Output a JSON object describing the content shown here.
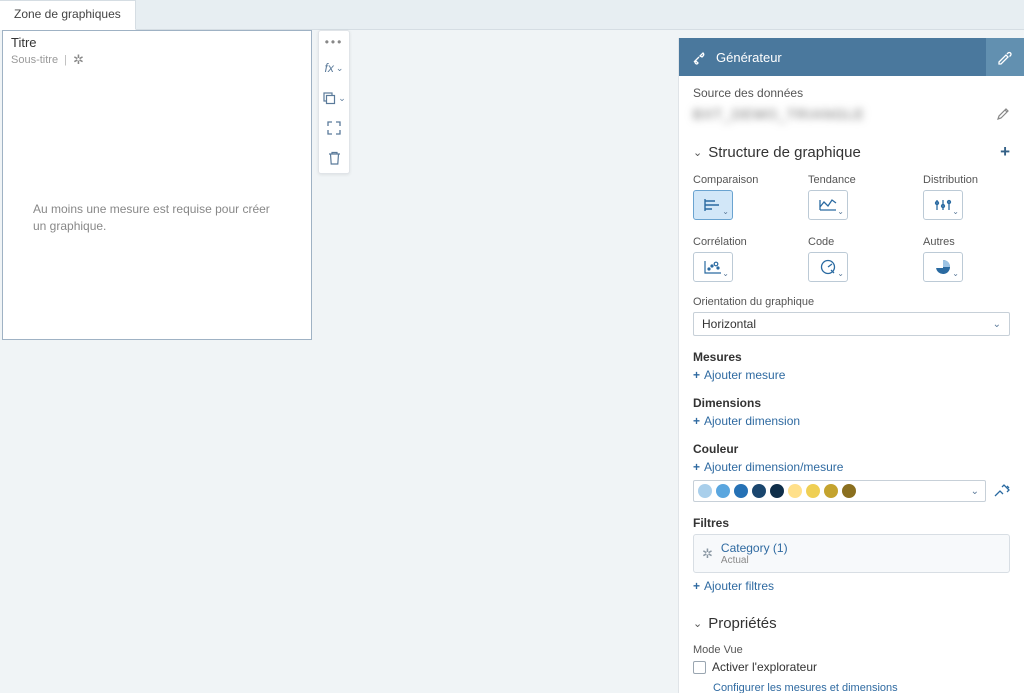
{
  "tabs": {
    "chart_area": "Zone de graphiques"
  },
  "chart_box": {
    "title": "Titre",
    "subtitle": "Sous-titre",
    "required_msg": "Au moins une mesure est requise pour créer un graphique."
  },
  "generator": {
    "title": "Générateur",
    "source_label": "Source des données",
    "source_name": "BXT_DEMO_TRIANGLE"
  },
  "structure": {
    "title": "Structure de graphique",
    "types": {
      "comparison": "Comparaison",
      "trend": "Tendance",
      "distribution": "Distribution",
      "correlation": "Corrélation",
      "code": "Code",
      "others": "Autres"
    },
    "orientation_label": "Orientation du graphique",
    "orientation_value": "Horizontal",
    "measures_title": "Mesures",
    "add_measure": "Ajouter mesure",
    "dimensions_title": "Dimensions",
    "add_dimension": "Ajouter dimension",
    "color_title": "Couleur",
    "add_dim_measure": "Ajouter dimension/mesure",
    "palette": [
      "#a9cfeb",
      "#5aa6df",
      "#2571b5",
      "#1a466e",
      "#0f2e49",
      "#ffe08a",
      "#efcf54",
      "#c4a32e",
      "#8a6f1f"
    ],
    "filters_title": "Filtres",
    "filter_item_title": "Category (1)",
    "filter_item_sub": "Actual",
    "add_filters": "Ajouter filtres"
  },
  "properties": {
    "title": "Propriétés",
    "view_mode": "Mode Vue",
    "enable_explorer": "Activer l'explorateur",
    "configure_link": "Configurer les mesures et dimensions"
  }
}
